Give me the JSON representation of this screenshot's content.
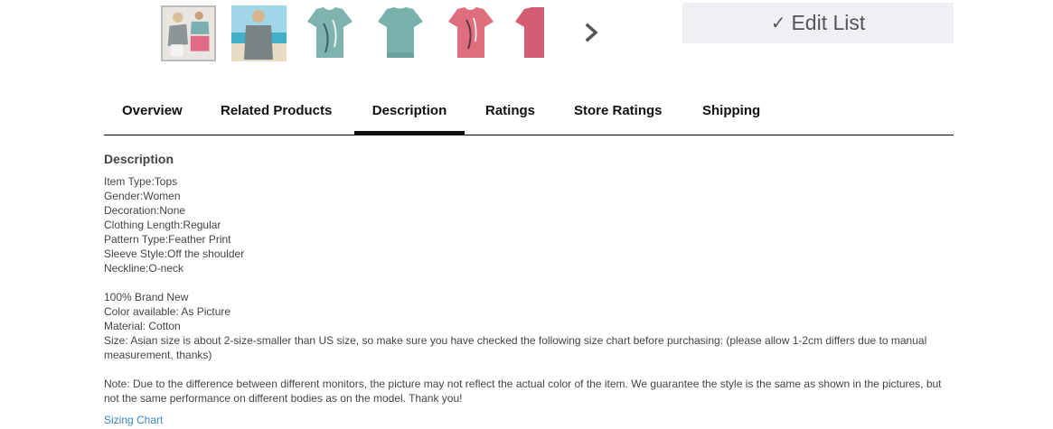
{
  "gallery": {
    "thumbnails": [
      {
        "name": "two-models",
        "color": "#7cb0b0"
      },
      {
        "name": "beach-model",
        "color": "#6cb5c9"
      },
      {
        "name": "teal-front",
        "color": "#7fb3ad"
      },
      {
        "name": "teal-back",
        "color": "#79b2ab"
      },
      {
        "name": "pink-front",
        "color": "#de6e7e"
      },
      {
        "name": "pink-back",
        "color": "#d45e71"
      }
    ],
    "next_icon": "chevron-right-icon"
  },
  "edit_list": {
    "check": "✓",
    "label": "Edit List"
  },
  "tabs": [
    {
      "label": "Overview"
    },
    {
      "label": "Related Products"
    },
    {
      "label": "Description"
    },
    {
      "label": "Ratings"
    },
    {
      "label": "Store Ratings"
    },
    {
      "label": "Shipping"
    }
  ],
  "active_tab": "Description",
  "description": {
    "heading": "Description",
    "specs": [
      "Item Type:Tops",
      "Gender:Women",
      "Decoration:None",
      "Clothing Length:Regular",
      "Pattern Type:Feather Print",
      "Sleeve Style:Off the shoulder",
      "Neckline:O-neck"
    ],
    "details": [
      "100% Brand New",
      "Color available: As Picture",
      "Material: Cotton",
      "Size: Asian size is about 2-size-smaller than US size, so make sure you have checked the following size chart before purchasing: (please allow 1-2cm differs due to manual measurement, thanks)"
    ],
    "note": "Note: Due to the difference between different monitors, the picture may not reflect the actual color of the item. We guarantee the style is the same as shown in the pictures, but not the same performance on different bodies as on the model. Thank you!",
    "sizing_link": "Sizing Chart"
  },
  "colors": {
    "accent_link": "#3a84c4",
    "button_bg": "#eef0f4"
  }
}
